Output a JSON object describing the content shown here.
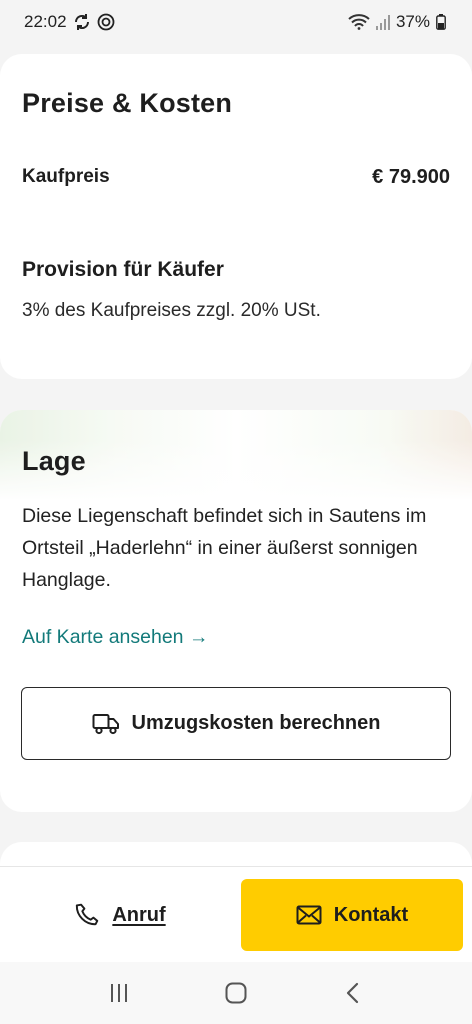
{
  "status_bar": {
    "time": "22:02",
    "battery": "37%",
    "icons_left": [
      "sync-icon",
      "data-saver-icon"
    ],
    "icons_right": [
      "wifi-icon",
      "signal-icon",
      "battery-icon"
    ]
  },
  "prices": {
    "title": "Preise & Kosten",
    "purchase_price_label": "Kaufpreis",
    "purchase_price_value": "€ 79.900",
    "commission_title": "Provision für Käufer",
    "commission_text": "3% des Kaufpreises zzgl. 20% USt."
  },
  "location": {
    "title": "Lage",
    "description": "Diese Liegenschaft befindet sich in Sautens im Ortsteil „Haderlehn“ in einer äußerst sonnigen Hanglage.",
    "map_link": "Auf Karte ansehen →",
    "moving_cost_button": "Umzugskosten berechnen",
    "moving_cost_icon": "truck-icon"
  },
  "actions": {
    "call_label": "Anruf",
    "call_icon": "phone-icon",
    "contact_label": "Kontakt",
    "contact_icon": "mail-icon",
    "contact_color": "#ffcc00"
  },
  "nav_bar": {
    "buttons": [
      "recent-apps-icon",
      "home-icon",
      "back-icon"
    ]
  },
  "colors": {
    "link": "#137a7a",
    "background": "#f4f4f4"
  }
}
